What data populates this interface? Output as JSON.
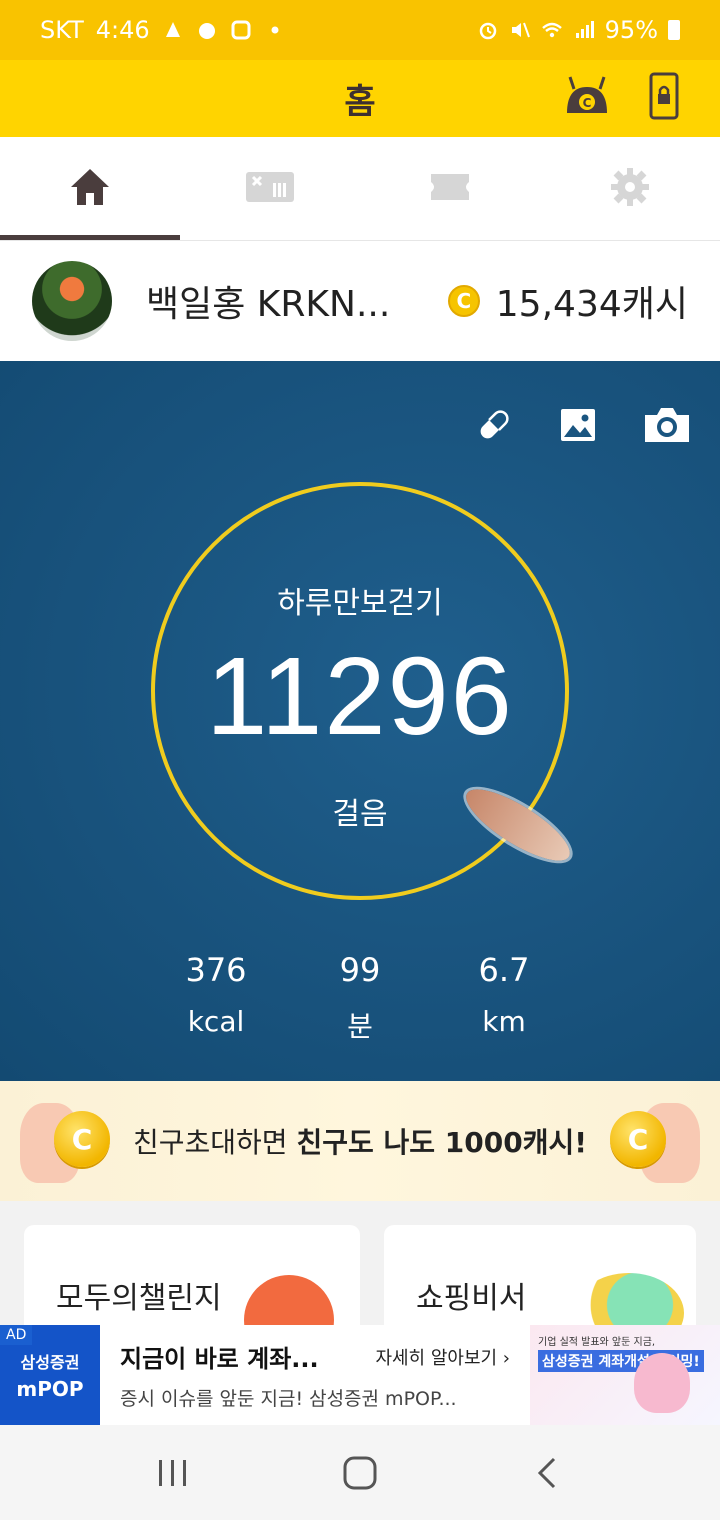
{
  "status_bar": {
    "carrier": "SKT",
    "time": "4:46",
    "battery": "95%"
  },
  "app_bar": {
    "title": "홈"
  },
  "tabs": [
    {
      "name": "home",
      "active": true
    },
    {
      "name": "gift",
      "active": false
    },
    {
      "name": "ticket",
      "active": false
    },
    {
      "name": "settings",
      "active": false
    }
  ],
  "profile": {
    "name": "백일홍 KRKN...",
    "cash_amount": "15,434캐시",
    "coin_symbol": "C"
  },
  "walk": {
    "goal_label": "하루만보걷기",
    "steps": "11296",
    "steps_unit": "걸음",
    "stats": [
      {
        "value": "376",
        "unit": "kcal"
      },
      {
        "value": "99",
        "unit": "분"
      },
      {
        "value": "6.7",
        "unit": "km"
      }
    ]
  },
  "invite_banner": {
    "text_normal": "친구초대하면 ",
    "text_bold": "친구도 나도 1000캐시!",
    "coin_symbol": "C"
  },
  "cards": {
    "challenge_title": "모두의챌린지",
    "shopping_title": "쇼핑비서"
  },
  "ad": {
    "tag": "AD",
    "logo_line1": "삼성증권",
    "logo_line2": "mPOP",
    "headline": "지금이 바로 계좌...",
    "more_label": "자세히 알아보기 ›",
    "description": "증시 이슈를 앞둔 지금! 삼성증권 mPOP...",
    "thumb_line1": "기업 실적 발표와 앞둔 지금,",
    "thumb_line2": "삼성증권 계좌개설 타이밍!"
  },
  "colors": {
    "status_bar": "#f9c300",
    "app_bar": "#ffd400",
    "ring": "#f0cc1e",
    "ocean": "#1a5580",
    "ad_blue": "#1454c8"
  }
}
